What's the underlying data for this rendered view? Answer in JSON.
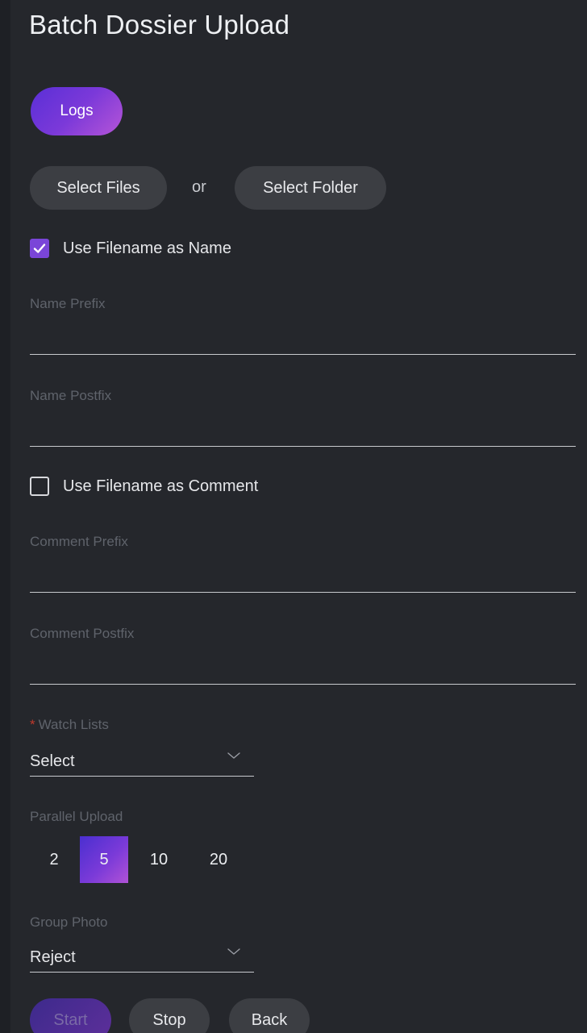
{
  "page": {
    "title": "Batch Dossier Upload"
  },
  "buttons": {
    "logs": "Logs",
    "select_files": "Select Files",
    "or": "or",
    "select_folder": "Select Folder",
    "start": "Start",
    "stop": "Stop",
    "back": "Back"
  },
  "options": {
    "use_filename_as_name": {
      "label": "Use Filename as Name",
      "checked": true
    },
    "use_filename_as_comment": {
      "label": "Use Filename as Comment",
      "checked": false
    }
  },
  "fields": {
    "name_prefix": {
      "label": "Name Prefix",
      "value": ""
    },
    "name_postfix": {
      "label": "Name Postfix",
      "value": ""
    },
    "comment_prefix": {
      "label": "Comment Prefix",
      "value": ""
    },
    "comment_postfix": {
      "label": "Comment Postfix",
      "value": ""
    }
  },
  "watch_lists": {
    "required_mark": "*",
    "label": "Watch Lists",
    "value": "Select"
  },
  "parallel_upload": {
    "label": "Parallel Upload",
    "options": [
      "2",
      "5",
      "10",
      "20"
    ],
    "selected": "5"
  },
  "group_photo": {
    "label": "Group Photo",
    "value": "Reject"
  },
  "colors": {
    "background": "#25272c",
    "accent": "#7a45d8",
    "pill": "#3c3e43",
    "muted_label": "#5f636b",
    "required": "#c0392b"
  },
  "icons": {
    "checkmark": "check-icon",
    "dropdown": "chevron-down-icon"
  }
}
